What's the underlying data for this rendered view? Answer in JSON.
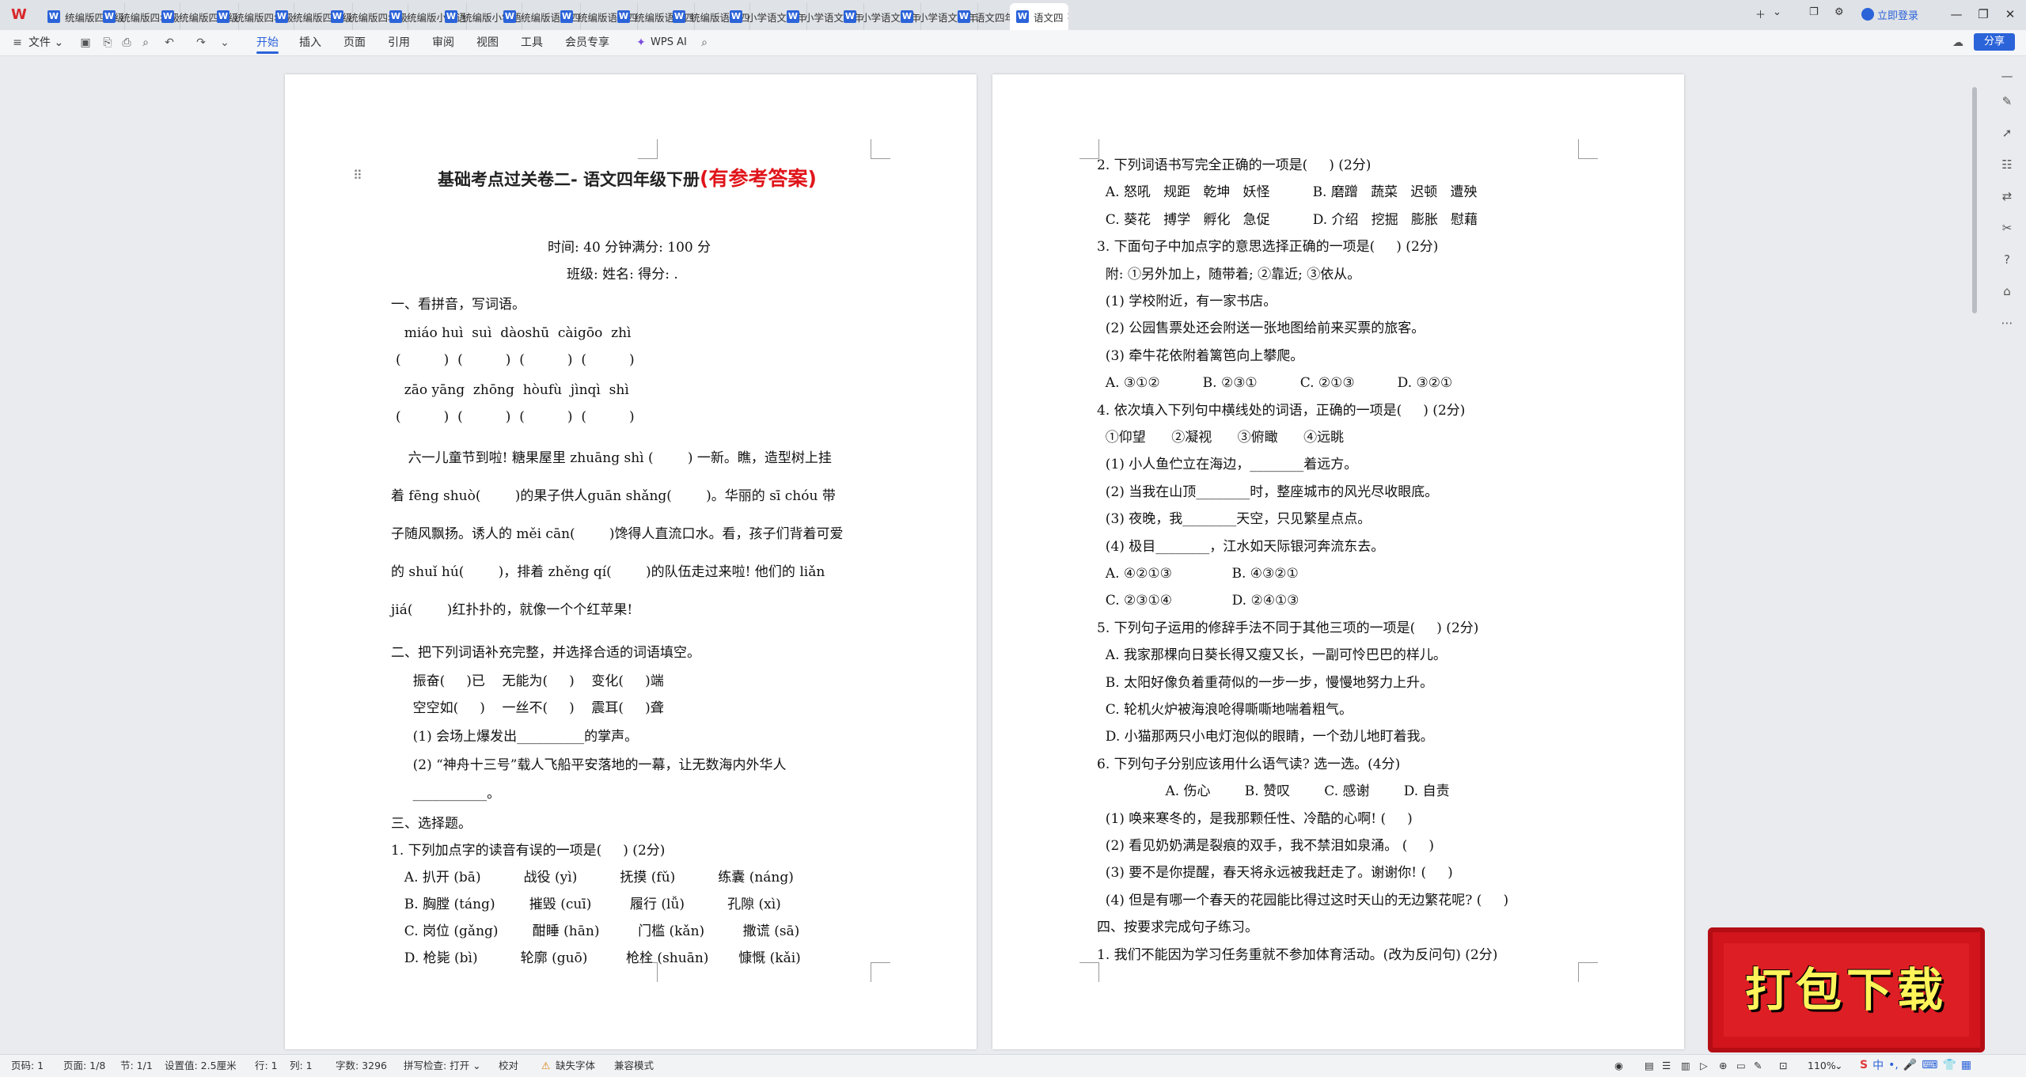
{
  "tabs": [
    "统编版四年级",
    "统编版四年级",
    "统编版四年级",
    "统编版四年级",
    "统编版四年级",
    "统编版四年级",
    "统编版小学语",
    "统编版小学语",
    "统编版语文四",
    "统编版语文四",
    "统编版语文四",
    "统编版语文四",
    "小学语文四年",
    "小学语文四年",
    "小学语文四年",
    "小学语文四年",
    "语文四年级下",
    "语文四"
  ],
  "title_bar": {
    "login": "立即登录"
  },
  "ribbon": {
    "file": "文件",
    "tabs": [
      "开始",
      "插入",
      "页面",
      "引用",
      "审阅",
      "视图",
      "工具",
      "会员专享"
    ],
    "active": "开始",
    "ai": "WPS AI",
    "share": "分享"
  },
  "left_page": {
    "title_black": "基础考点过关卷二- 语文四年级下册",
    "title_red": "(有参考答案)",
    "info1": "时间: 40 分钟满分: 100 分",
    "info2": "班级: 姓名: 得分: .",
    "lines": [
      "一、看拼音，写词语。",
      "  miáo huì  suì  dàoshū  càigōo  zhì",
      "(          )  (          )  (          )  (          )",
      "  zāo yāng  zhōng  hòufù  jìnqì  shì",
      "(          )  (          )  (          )  (          )",
      "    六一儿童节到啦! 糖果屋里 zhuāng shì (        ) 一新。瞧，造型树上挂",
      "着 fēng shuò(        )的果子供人guān shǎng(        )。华丽的 sī chóu 带",
      "子随风飘扬。诱人的 měi cān(        )馋得人直流口水。看，孩子们背着可爱",
      "的 shuǐ hú(        )，排着 zhěng qí(        )的队伍走过来啦! 他们的 liǎn",
      "jiá(        )红扑扑的，就像一个个红苹果!",
      "二、把下列词语补充完整，并选择合适的词语填空。",
      "    振奋(     )已    无能为(     )    变化(     )端",
      "    空空如(     )    一丝不(     )    震耳(     )聋",
      "    (1) 会场上爆发出__________的掌声。",
      "    (2) “神舟十三号”载人飞船平安落地的一幕，让无数海内外华人",
      "    ___________。",
      "三、选择题。",
      "1. 下列加点字的读音有误的一项是(     ) (2分)",
      "  A. 扒开 (bā)          战役 (yì)          抚摸 (fǔ)          练囊 (náng)",
      "  B. 胸膛 (táng)        摧毁 (cuī)         履行 (lǚ)          孔隙 (xì)",
      "  C. 岗位 (gǎng)        酣睡 (hān)         门槛 (kǎn)         撒谎 (sā)",
      "  D. 枪毙 (bì)          轮廓 (guō)         枪栓 (shuān)       慷慨 (kǎi)"
    ]
  },
  "right_page": {
    "lines": [
      "2. 下列词语书写完全正确的一项是(     ) (2分)",
      "  A. 怒吼   规距   乾坤   妖怪          B. 磨蹭   蔬菜   迟顿   遭殃",
      "  C. 葵花   搏学   孵化   急促          D. 介绍   挖掘   膨胀   慰藉",
      "3. 下面句子中加点字的意思选择正确的一项是(     ) (2分)",
      "  附: ①另外加上，随带着; ②靠近; ③依从。",
      "  (1) 学校附近，有一家书店。",
      "  (2) 公园售票处还会附送一张地图给前来买票的旅客。",
      "  (3) 牵牛花依附着篱笆向上攀爬。",
      "  A. ③①②          B. ②③①          C. ②①③          D. ③②①",
      "4. 依次填入下列句中横线处的词语，正确的一项是(     ) (2分)",
      "  ①仰望      ②凝视      ③俯瞰      ④远眺",
      "  (1) 小人鱼伫立在海边，________着远方。",
      "  (2) 当我在山顶________时，整座城市的风光尽收眼底。",
      "  (3) 夜晚，我________天空，只见繁星点点。",
      "  (4) 极目________，江水如天际银河奔流东去。",
      "  A. ④②①③              B. ④③②①",
      "  C. ②③①④              D. ②④①③",
      "5. 下列句子运用的修辞手法不同于其他三项的一项是(     ) (2分)",
      "  A. 我家那棵向日葵长得又瘦又长，一副可怜巴巴的样儿。",
      "  B. 太阳好像负着重荷似的一步一步，慢慢地努力上升。",
      "  C. 轮机火炉被海浪呛得嘶嘶地喘着粗气。",
      "  D. 小猫那两只小电灯泡似的眼睛，一个劲儿地盯着我。",
      "6. 下列句子分别应该用什么语气读? 选一选。(4分)",
      "                A. 伤心        B. 赞叹        C. 感谢        D. 自责",
      "  (1) 唤来寒冬的，是我那颗任性、冷酷的心啊! (     )",
      "  (2) 看见奶奶满是裂痕的双手，我不禁泪如泉涌。 (     )",
      "  (3) 要不是你提醒，春天将永远被我赶走了。谢谢你! (     )",
      "  (4) 但是有哪一个春天的花园能比得过这时天山的无边繁花呢? (     )",
      "四、按要求完成句子练习。",
      "1. 我们不能因为学习任务重就不参加体育活动。(改为反问句) (2分)"
    ]
  },
  "status_bar": {
    "page": "页码: 1",
    "pages": "页面: 1/8",
    "section": "节: 1/1",
    "setting": "设置值: 2.5厘米",
    "row": "行: 1",
    "col": "列: 1",
    "words": "字数: 3296",
    "spell": "拼写检查: 打开",
    "proof": "校对",
    "missing_font": "缺失字体",
    "compat": "兼容模式",
    "zoom": "110%"
  },
  "banner": {
    "text": "打包下载"
  },
  "ime": {
    "text": "中"
  },
  "colors": {
    "accent": "#2b63d9",
    "title_red": "#e0151b",
    "banner_red": "#d2141c",
    "banner_text": "#fff45a"
  }
}
